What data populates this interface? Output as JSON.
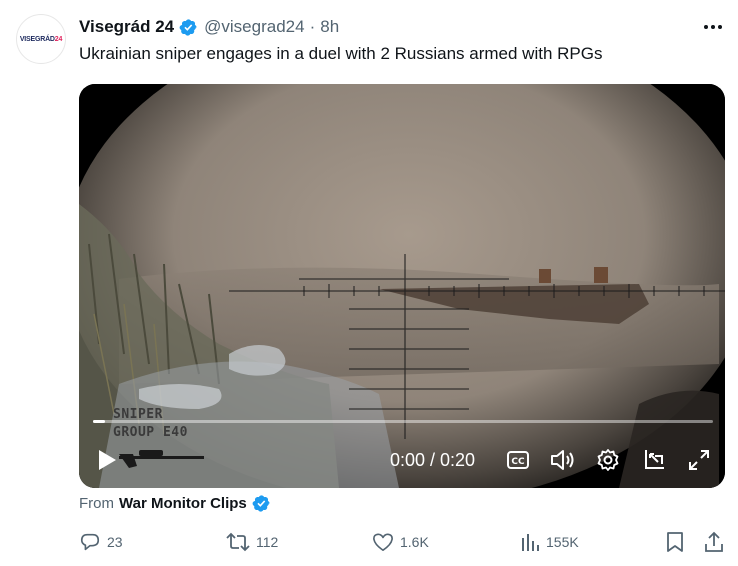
{
  "author": {
    "name": "Visegrád 24",
    "handle": "@visegrad24",
    "separator": "·",
    "time": "8h",
    "avatar_text_main": "VISEGRÁD",
    "avatar_text_num": "24"
  },
  "tweet": {
    "text": "Ukrainian sniper engages in a duel with 2 Russians armed with RPGs"
  },
  "video": {
    "overlay_line1": "SNIPER",
    "overlay_line2": "GROUP E40",
    "timecode": "0:00 / 0:20",
    "progress": 0.02
  },
  "attribution": {
    "prefix": "From",
    "source": "War Monitor Clips"
  },
  "actions": {
    "replies": "23",
    "reposts": "112",
    "likes": "1.6K",
    "views": "155K"
  },
  "colors": {
    "verified": "#1d9bf0",
    "text": "#0f1419",
    "muted": "#536471"
  },
  "icons": [
    "verified-icon",
    "more-icon",
    "play-icon",
    "cc-icon",
    "volume-icon",
    "settings-icon",
    "minimize-icon",
    "fullscreen-icon",
    "reply-icon",
    "repost-icon",
    "like-icon",
    "views-icon",
    "bookmark-icon",
    "share-icon"
  ]
}
